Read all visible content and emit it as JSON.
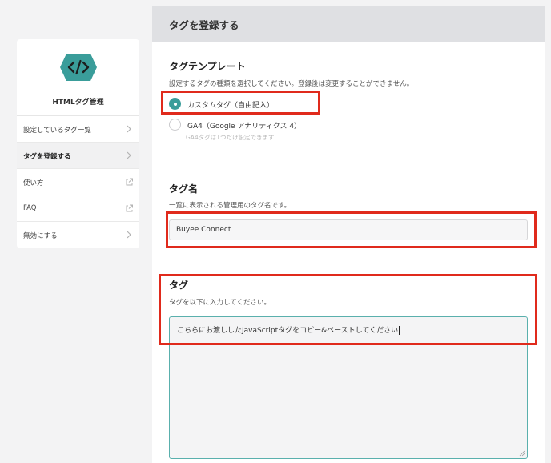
{
  "sidebar": {
    "app_title": "HTMLタグ管理",
    "items": [
      {
        "label": "設定しているタグ一覧",
        "icon": "chevron-right-icon"
      },
      {
        "label": "タグを登録する",
        "icon": "chevron-right-icon"
      },
      {
        "label": "使い方",
        "icon": "external-link-icon"
      },
      {
        "label": "FAQ",
        "icon": "external-link-icon"
      },
      {
        "label": "無効にする",
        "icon": "chevron-right-icon"
      }
    ],
    "active_index": 1
  },
  "main": {
    "header": "タグを登録する",
    "template": {
      "title": "タグテンプレート",
      "description": "設定するタグの種類を選択してください。登録後は変更することができません。",
      "options": [
        {
          "label": "カスタムタグ（自由記入）",
          "checked": true
        },
        {
          "label": "GA4（Google アナリティクス 4）",
          "checked": false,
          "note": "GA4タグは1つだけ設定できます"
        }
      ]
    },
    "tag_name": {
      "title": "タグ名",
      "description": "一覧に表示される管理用のタグ名です。",
      "value": "Buyee Connect"
    },
    "tag": {
      "title": "タグ",
      "description": "タグを以下に入力してください。",
      "value": "こちらにお渡ししたJavaScriptタグをコピー&ペーストしてください"
    }
  },
  "colors": {
    "accent": "#3a9d9a",
    "highlight": "#e02a1c",
    "header_bg": "#dfe0e3",
    "page_bg": "#f3f3f4"
  }
}
